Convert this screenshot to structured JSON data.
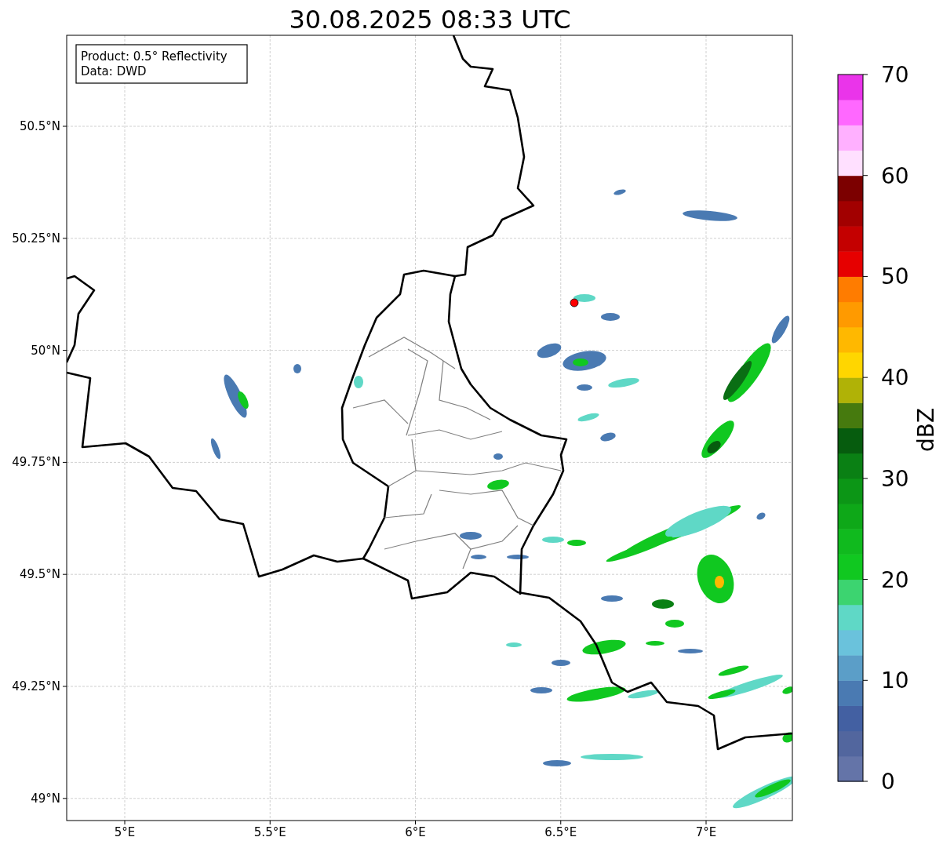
{
  "title": "30.08.2025 08:33 UTC",
  "map": {
    "info_box": [
      "Product: 0.5° Reflectivity",
      "Data: DWD"
    ],
    "lon_ticks": [
      "5°E",
      "5.5°E",
      "6°E",
      "6.5°E",
      "7°E"
    ],
    "lat_ticks": [
      "50.5°N",
      "50.25°N",
      "50°N",
      "49.75°N",
      "49.5°N",
      "49.25°N",
      "49°N"
    ]
  },
  "colorbar": {
    "label": "dBZ",
    "ticks": [
      "70",
      "60",
      "50",
      "40",
      "30",
      "20",
      "10",
      "0"
    ],
    "segments": [
      {
        "color": "#6474a8"
      },
      {
        "color": "#52669e"
      },
      {
        "color": "#4360a2"
      },
      {
        "color": "#4a7ab2"
      },
      {
        "color": "#5b9ec8"
      },
      {
        "color": "#6ac2dc"
      },
      {
        "color": "#5fd8c6"
      },
      {
        "color": "#3cd470"
      },
      {
        "color": "#10c820"
      },
      {
        "color": "#10ba1e"
      },
      {
        "color": "#0ea818"
      },
      {
        "color": "#0c9616"
      },
      {
        "color": "#0a8014"
      },
      {
        "color": "#065c0e"
      },
      {
        "color": "#467a0e"
      },
      {
        "color": "#b0b206"
      },
      {
        "color": "#ffd600"
      },
      {
        "color": "#ffb800"
      },
      {
        "color": "#ff9a00"
      },
      {
        "color": "#ff7c00"
      },
      {
        "color": "#e60000"
      },
      {
        "color": "#c40000"
      },
      {
        "color": "#a20000"
      },
      {
        "color": "#7c0000"
      },
      {
        "color": "#ffe0ff"
      },
      {
        "color": "#ffb0ff"
      },
      {
        "color": "#ff68ff"
      },
      {
        "color": "#ea34ea"
      }
    ]
  }
}
